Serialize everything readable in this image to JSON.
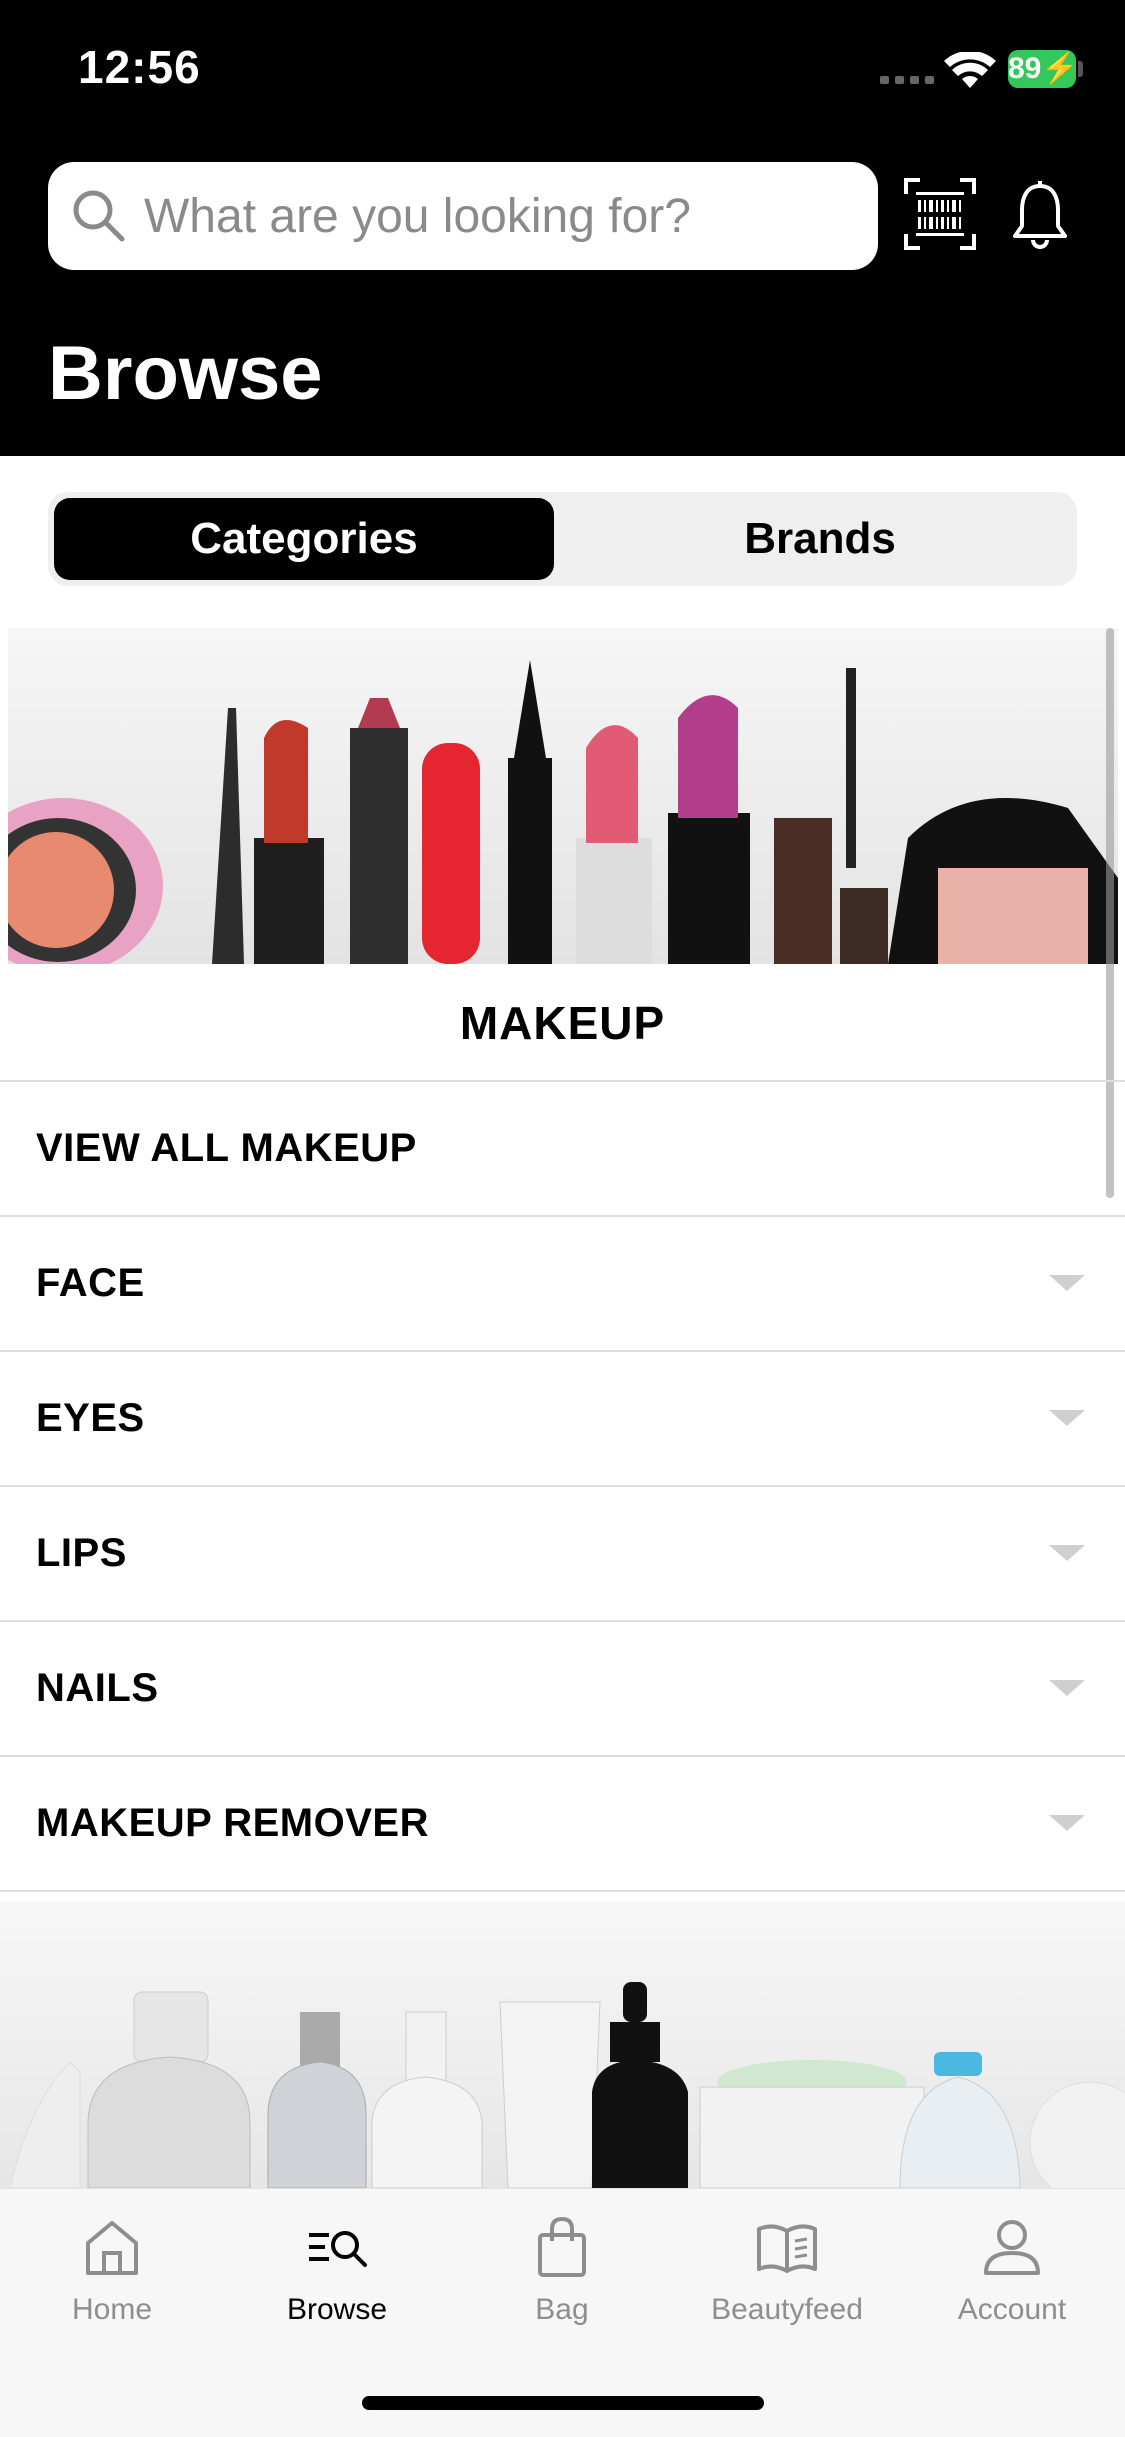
{
  "status": {
    "time": "12:56",
    "battery": "89"
  },
  "search": {
    "placeholder": "What are you looking for?"
  },
  "header": {
    "title": "Browse"
  },
  "segments": {
    "categories": "Categories",
    "brands": "Brands"
  },
  "section": {
    "title": "MAKEUP"
  },
  "categories": [
    {
      "label": "VIEW ALL MAKEUP",
      "expandable": false
    },
    {
      "label": "FACE",
      "expandable": true
    },
    {
      "label": "EYES",
      "expandable": true
    },
    {
      "label": "LIPS",
      "expandable": true
    },
    {
      "label": "NAILS",
      "expandable": true
    },
    {
      "label": "MAKEUP REMOVER",
      "expandable": true
    }
  ],
  "tabbar": {
    "home": "Home",
    "browse": "Browse",
    "bag": "Bag",
    "beautyfeed": "Beautyfeed",
    "account": "Account",
    "active": "browse"
  },
  "icons": [
    "search-icon",
    "barcode-icon",
    "bell-icon",
    "home-icon",
    "browse-icon",
    "bag-icon",
    "book-icon",
    "account-icon",
    "chevron-down-icon"
  ],
  "colors": {
    "header_bg": "#000000",
    "battery": "#34c759",
    "tab_inactive": "#8e8e8e"
  }
}
